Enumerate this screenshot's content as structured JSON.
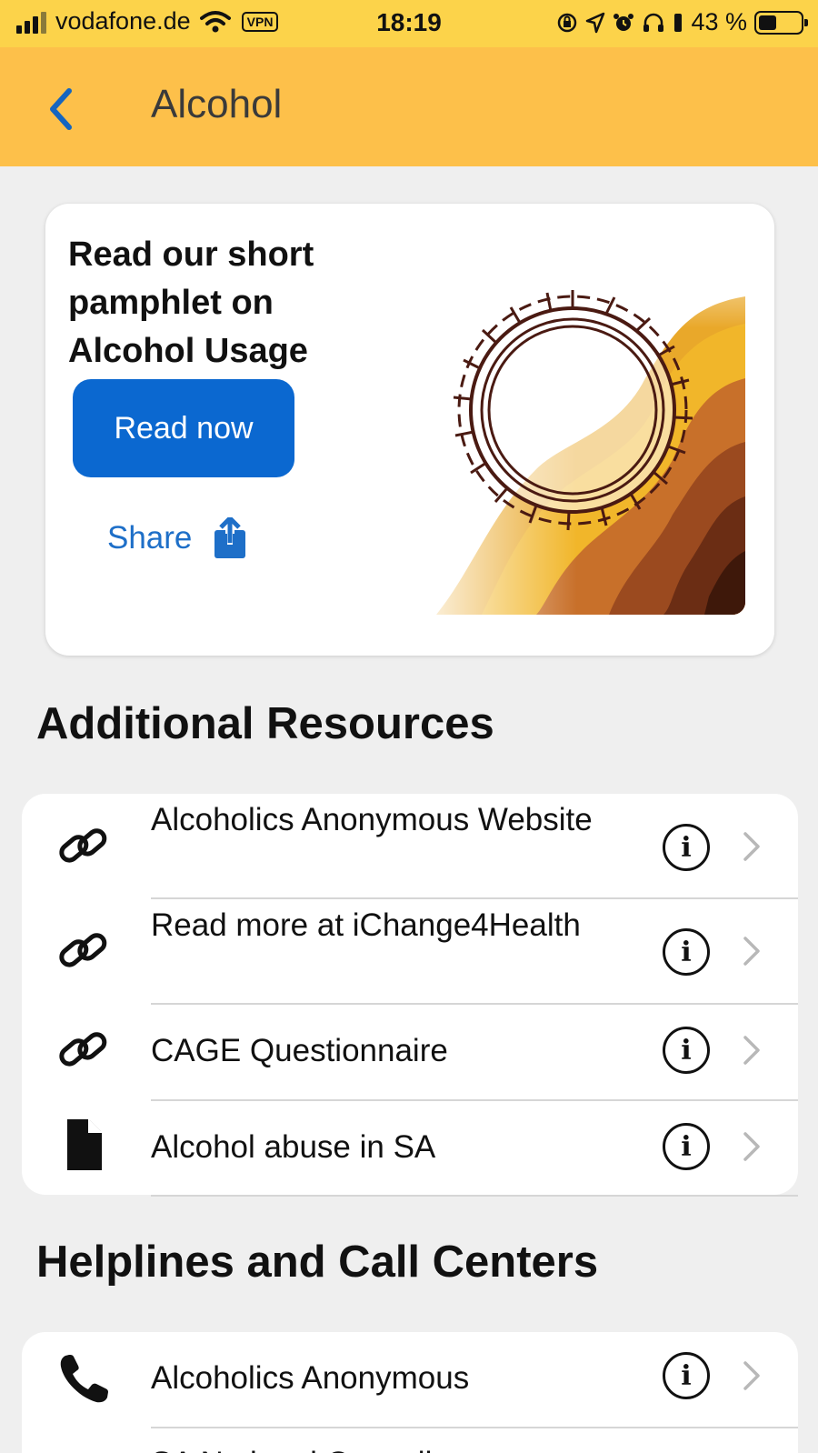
{
  "status_bar": {
    "carrier": "vodafone.de",
    "vpn": "VPN",
    "time": "18:19",
    "battery_percent": "43 %",
    "battery_level": 0.43
  },
  "nav": {
    "title": "Alcohol"
  },
  "promo": {
    "title": "Read our short pamphlet on Alcohol Usage",
    "read_button": "Read now",
    "share_label": "Share"
  },
  "resources": {
    "heading": "Additional Resources",
    "items": [
      {
        "label": "Alcoholics Anonymous Website",
        "icon": "link-icon"
      },
      {
        "label": "Read more at iChange4Health",
        "icon": "link-icon"
      },
      {
        "label": "CAGE Questionnaire",
        "icon": "link-icon"
      },
      {
        "label": "Alcohol abuse in SA",
        "icon": "document-icon"
      }
    ],
    "info_glyph": "i"
  },
  "helplines": {
    "heading": "Helplines and Call Centers",
    "items": [
      {
        "label": "Alcoholics Anonymous",
        "icon": "phone-icon"
      },
      {
        "label": "SA National Council on",
        "icon": "phone-icon"
      }
    ]
  },
  "colors": {
    "status_bar": "#fcd34a",
    "nav_bar": "#fdc04a",
    "primary_button": "#0b68d0",
    "link": "#1e6fc8",
    "background": "#efefef"
  }
}
